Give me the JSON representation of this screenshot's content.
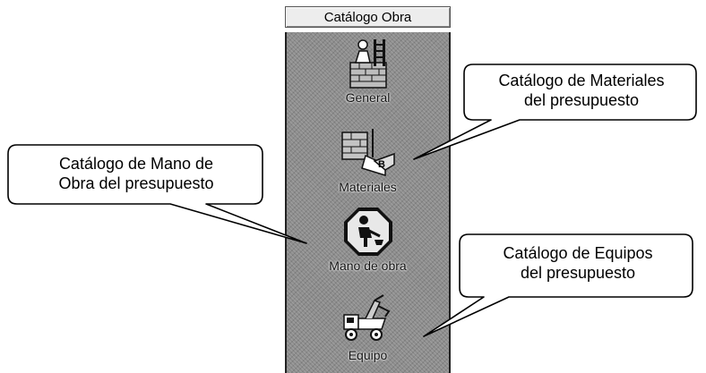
{
  "panel": {
    "title": "Catálogo Obra",
    "items": [
      {
        "label": "General",
        "icon": "general-catalog-icon"
      },
      {
        "label": "Materiales",
        "icon": "materials-catalog-icon"
      },
      {
        "label": "Mano de obra",
        "icon": "labor-catalog-icon"
      },
      {
        "label": "Equipo",
        "icon": "equipment-catalog-icon"
      }
    ]
  },
  "callouts": {
    "materiales": {
      "line1": "Catálogo de Materiales",
      "line2": "del presupuesto"
    },
    "mano_obra": {
      "line1": "Catálogo de Mano de",
      "line2": "Obra del presupuesto"
    },
    "equipos": {
      "line1": "Catálogo de Equipos",
      "line2": "del presupuesto"
    }
  },
  "colors": {
    "panel_bg": "#8d8d8d",
    "callout_border": "#000000",
    "callout_bg": "#ffffff"
  }
}
